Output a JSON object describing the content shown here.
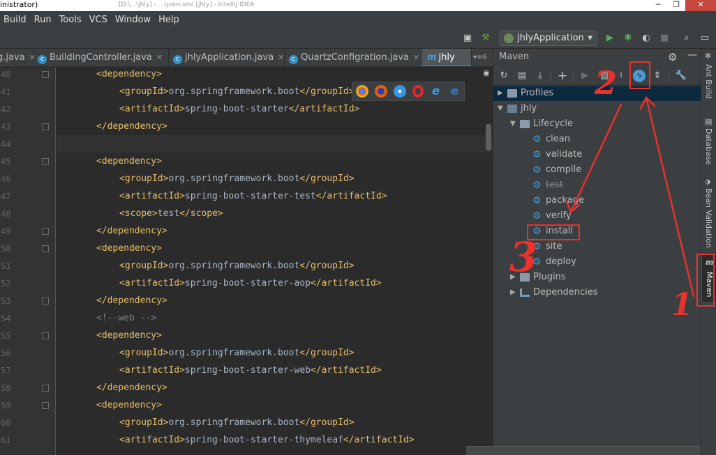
{
  "window": {
    "title": "inistrator)",
    "ghost_title": "[D:\\...\\jhly] - ...\\pom.xml [jhly] - IntelliJ IDEA",
    "controls": [
      "─",
      "❐",
      "✕"
    ]
  },
  "menu": [
    "Build",
    "Run",
    "Tools",
    "VCS",
    "Window",
    "Help"
  ],
  "toolbar": {
    "run_config": "jhlyApplication"
  },
  "tabs": [
    {
      "label": "g.java",
      "icon": "class-icon"
    },
    {
      "label": "BuildingController.java",
      "icon": "class-icon"
    },
    {
      "label": "jhlyApplication.java",
      "icon": "class-icon"
    },
    {
      "label": "QuartzConfigration.java",
      "icon": "class-icon"
    },
    {
      "label": "jhly",
      "icon": "maven-icon",
      "active": true
    }
  ],
  "tab_overflow": "▾≡6",
  "editor": {
    "lines": [
      {
        "num": "40",
        "indent": 1,
        "parts": [
          [
            "tag",
            "<dependency>"
          ]
        ]
      },
      {
        "num": "41",
        "indent": 2,
        "parts": [
          [
            "tag",
            "<groupId>"
          ],
          [
            "txt",
            "org.springframework.boot"
          ],
          [
            "tag",
            "</groupId>"
          ]
        ]
      },
      {
        "num": "42",
        "indent": 2,
        "parts": [
          [
            "tag",
            "<artifactId>"
          ],
          [
            "txt",
            "spring-boot-starter"
          ],
          [
            "tag",
            "</artifactId>"
          ]
        ]
      },
      {
        "num": "43",
        "indent": 1,
        "parts": [
          [
            "tag",
            "</dependency>"
          ]
        ]
      },
      {
        "num": "44",
        "indent": 0,
        "parts": []
      },
      {
        "num": "45",
        "indent": 1,
        "parts": [
          [
            "tag",
            "<dependency>"
          ]
        ]
      },
      {
        "num": "46",
        "indent": 2,
        "parts": [
          [
            "tag",
            "<groupId>"
          ],
          [
            "txt",
            "org.springframework.boot"
          ],
          [
            "tag",
            "</groupId>"
          ]
        ]
      },
      {
        "num": "47",
        "indent": 2,
        "parts": [
          [
            "tag",
            "<artifactId>"
          ],
          [
            "txt",
            "spring-boot-starter-test"
          ],
          [
            "tag",
            "</artifactId>"
          ]
        ]
      },
      {
        "num": "48",
        "indent": 2,
        "parts": [
          [
            "tag",
            "<scope>"
          ],
          [
            "txt",
            "test"
          ],
          [
            "tag",
            "</scope>"
          ]
        ]
      },
      {
        "num": "49",
        "indent": 1,
        "parts": [
          [
            "tag",
            "</dependency>"
          ]
        ]
      },
      {
        "num": "50",
        "indent": 1,
        "parts": [
          [
            "tag",
            "<dependency>"
          ]
        ]
      },
      {
        "num": "51",
        "indent": 2,
        "parts": [
          [
            "tag",
            "<groupId>"
          ],
          [
            "txt",
            "org.springframework.boot"
          ],
          [
            "tag",
            "</groupId>"
          ]
        ]
      },
      {
        "num": "52",
        "indent": 2,
        "parts": [
          [
            "tag",
            "<artifactId>"
          ],
          [
            "txt",
            "spring-boot-starter-aop"
          ],
          [
            "tag",
            "</artifactId>"
          ]
        ]
      },
      {
        "num": "53",
        "indent": 1,
        "parts": [
          [
            "tag",
            "</dependency>"
          ]
        ]
      },
      {
        "num": "54",
        "indent": 1,
        "parts": [
          [
            "cmt",
            "<!--web -->"
          ]
        ]
      },
      {
        "num": "55",
        "indent": 1,
        "parts": [
          [
            "tag",
            "<dependency>"
          ]
        ]
      },
      {
        "num": "56",
        "indent": 2,
        "parts": [
          [
            "tag",
            "<groupId>"
          ],
          [
            "txt",
            "org.springframework.boot"
          ],
          [
            "tag",
            "</groupId>"
          ]
        ]
      },
      {
        "num": "57",
        "indent": 2,
        "parts": [
          [
            "tag",
            "<artifactId>"
          ],
          [
            "txt",
            "spring-boot-starter-web"
          ],
          [
            "tag",
            "</artifactId>"
          ]
        ]
      },
      {
        "num": "58",
        "indent": 1,
        "parts": [
          [
            "tag",
            "</dependency>"
          ]
        ]
      },
      {
        "num": "59",
        "indent": 1,
        "parts": [
          [
            "tag",
            "<dependency>"
          ]
        ]
      },
      {
        "num": "60",
        "indent": 2,
        "parts": [
          [
            "tag",
            "<groupId>"
          ],
          [
            "txt",
            "org.springframework.boot"
          ],
          [
            "tag",
            "</groupId>"
          ]
        ]
      },
      {
        "num": "61",
        "indent": 2,
        "parts": [
          [
            "tag",
            "<artifactId>"
          ],
          [
            "txt",
            "spring-boot-starter-thymeleaf"
          ],
          [
            "tag",
            "</artifactId>"
          ]
        ]
      }
    ],
    "current_line": "44"
  },
  "maven": {
    "title": "Maven",
    "tree": [
      {
        "label": "Profiles",
        "level": 0,
        "arrow": "▶",
        "icon": "folder-icon",
        "selected": true
      },
      {
        "label": "jhly",
        "level": 0,
        "arrow": "▼",
        "icon": "maven-project-icon"
      },
      {
        "label": "Lifecycle",
        "level": 1,
        "arrow": "▼",
        "icon": "folder-icon"
      },
      {
        "label": "clean",
        "level": 2,
        "icon": "gear-icon"
      },
      {
        "label": "validate",
        "level": 2,
        "icon": "gear-icon"
      },
      {
        "label": "compile",
        "level": 2,
        "icon": "gear-icon"
      },
      {
        "label": "test",
        "level": 2,
        "icon": "gear-icon",
        "skipped": true
      },
      {
        "label": "package",
        "level": 2,
        "icon": "gear-icon"
      },
      {
        "label": "verify",
        "level": 2,
        "icon": "gear-icon"
      },
      {
        "label": "install",
        "level": 2,
        "icon": "gear-icon"
      },
      {
        "label": "site",
        "level": 2,
        "icon": "gear-icon"
      },
      {
        "label": "deploy",
        "level": 2,
        "icon": "gear-icon"
      },
      {
        "label": "Plugins",
        "level": 1,
        "arrow": "▶",
        "icon": "folder-icon"
      },
      {
        "label": "Dependencies",
        "level": 1,
        "arrow": "▶",
        "icon": "dependencies-icon"
      }
    ]
  },
  "side_tools": [
    "Ant Build",
    "Database",
    "Bean Validation",
    "Maven"
  ],
  "annotations": {
    "n1": "1",
    "n2": "2",
    "n3": "3"
  },
  "colors": {
    "annotation": "#e8322d",
    "tag": "#e8bf6a",
    "text": "#a9b7c6",
    "comment": "#808080",
    "maven_gear": "#4a9ad4"
  }
}
